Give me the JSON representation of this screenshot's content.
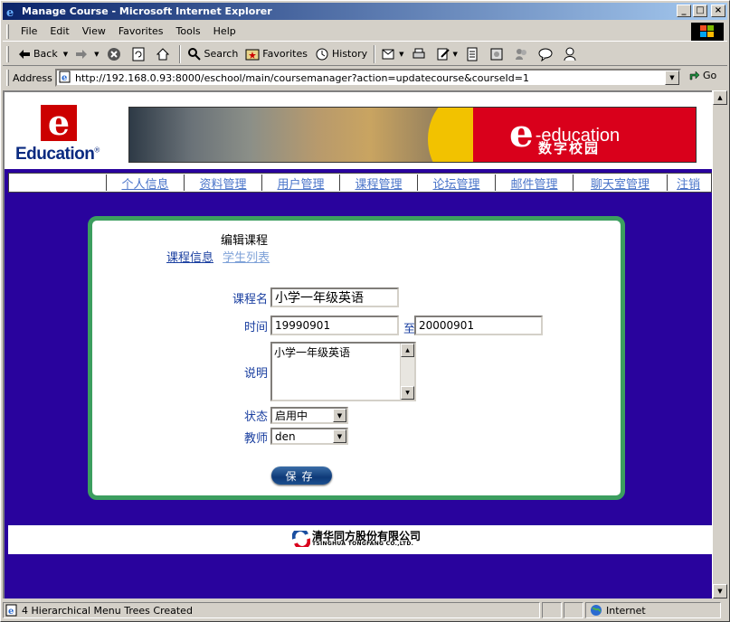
{
  "window": {
    "title": "Manage Course - Microsoft Internet Explorer"
  },
  "menu": [
    "File",
    "Edit",
    "View",
    "Favorites",
    "Tools",
    "Help"
  ],
  "toolbar": {
    "back": "Back",
    "search": "Search",
    "favorites": "Favorites",
    "history": "History"
  },
  "address": {
    "label": "Address",
    "url": "http://192.168.0.93:8000/eschool/main/coursemanager?action=updatecourse&courseId=1",
    "go": "Go"
  },
  "header": {
    "logo_letter": "e",
    "logo_text": "Education",
    "banner_title_e": "e",
    "banner_title_rest": "-education",
    "banner_subtitle": "数字校园"
  },
  "nav": [
    "个人信息",
    "资料管理",
    "用户管理",
    "课程管理",
    "论坛管理",
    "邮件管理",
    "聊天室管理",
    "注销"
  ],
  "form": {
    "heading": "编辑课程",
    "tab_info": "课程信息",
    "tab_students": "学生列表",
    "name_label": "课程名",
    "name_value": "小学一年级英语",
    "time_label": "时间",
    "start_date": "19990901",
    "to_label": "至",
    "end_date": "20000901",
    "desc_label": "说明",
    "desc_value": "小学一年级英语",
    "status_label": "状态",
    "status_value": "启用中",
    "teacher_label": "教师",
    "teacher_value": "den",
    "save_label": "保存"
  },
  "footer": {
    "company_cn": "清华同方股份有限公司",
    "company_en": "TSINGHUA TONGFANG CO.,LTD."
  },
  "status": {
    "message": "4 Hierarchical Menu Trees Created",
    "zone": "Internet"
  },
  "colors": {
    "page_bg": "#29039d",
    "card_border": "#3c9e5f",
    "brand_red": "#cc0000",
    "nav_link": "#4a74c9"
  }
}
